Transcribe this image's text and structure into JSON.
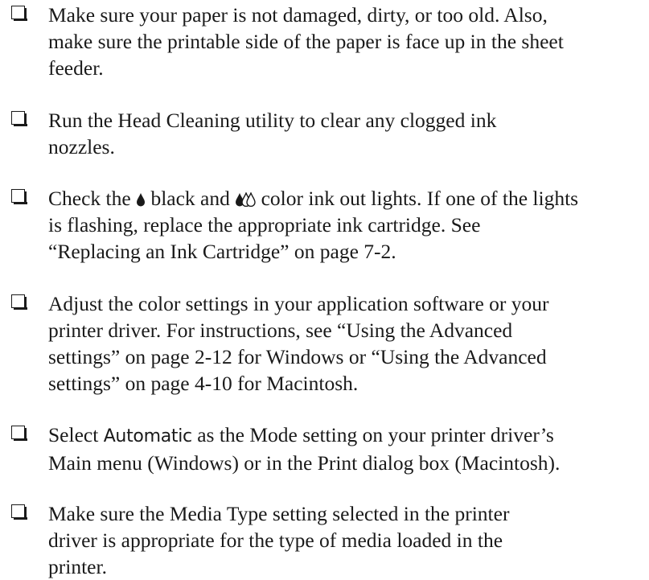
{
  "items": [
    {
      "line1": "Make sure your paper is not damaged, dirty, or too old. Also,",
      "line2": "make sure the printable side of the paper is face up in the sheet",
      "line3": "feeder."
    },
    {
      "line1": "Run the Head Cleaning utility to clear any clogged ink",
      "line2": "nozzles."
    },
    {
      "pre": "Check the",
      "black": "black and",
      "color": "color ink out lights. If one of the lights",
      "line2": "is flashing, replace the appropriate ink cartridge. See",
      "line3": "“Replacing an Ink Cartridge” on page 7-2."
    },
    {
      "line1": "Adjust the color settings in your application software or your",
      "line2": "printer driver. For instructions, see “Using the Advanced",
      "line3": "settings” on page 2-12 for Windows or “Using the Advanced",
      "line4": "settings” on page 4-10 for Macintosh."
    },
    {
      "pre": "Select",
      "mode": "Automatic",
      "post": "as the Mode setting on your printer driver’s",
      "line2": "Main menu (Windows) or in the Print dialog box (Macintosh)."
    },
    {
      "line1": "Make sure the Media Type setting selected in the printer",
      "line2": "driver is appropriate for the type of media loaded in the",
      "line3": "printer."
    }
  ],
  "icons": {
    "black": "black-ink-drop-icon",
    "color": "color-ink-drops-icon"
  }
}
